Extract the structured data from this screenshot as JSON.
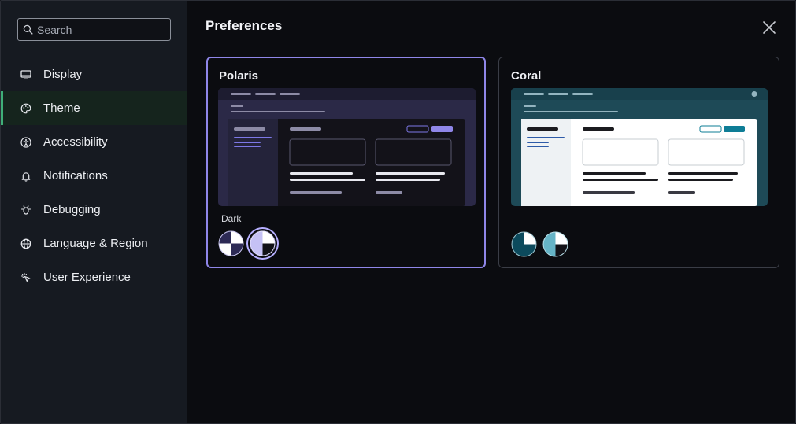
{
  "search": {
    "placeholder": "Search"
  },
  "sidebar": {
    "items": [
      {
        "label": "Display",
        "icon": "monitor-icon",
        "active": false
      },
      {
        "label": "Theme",
        "icon": "palette-icon",
        "active": true
      },
      {
        "label": "Accessibility",
        "icon": "accessibility-icon",
        "active": false
      },
      {
        "label": "Notifications",
        "icon": "bell-icon",
        "active": false
      },
      {
        "label": "Debugging",
        "icon": "bug-icon",
        "active": false
      },
      {
        "label": "Language & Region",
        "icon": "globe-icon",
        "active": false
      },
      {
        "label": "User Experience",
        "icon": "pointer-icon",
        "active": false
      }
    ],
    "active_accent": "#3fae78"
  },
  "main": {
    "title": "Preferences",
    "themes": [
      {
        "name": "Polaris",
        "selected": true,
        "variant_label": "Dark",
        "accent": "#8f86e8"
      },
      {
        "name": "Coral",
        "selected": false,
        "variant_label": "",
        "accent": "#0e7d96"
      }
    ]
  }
}
